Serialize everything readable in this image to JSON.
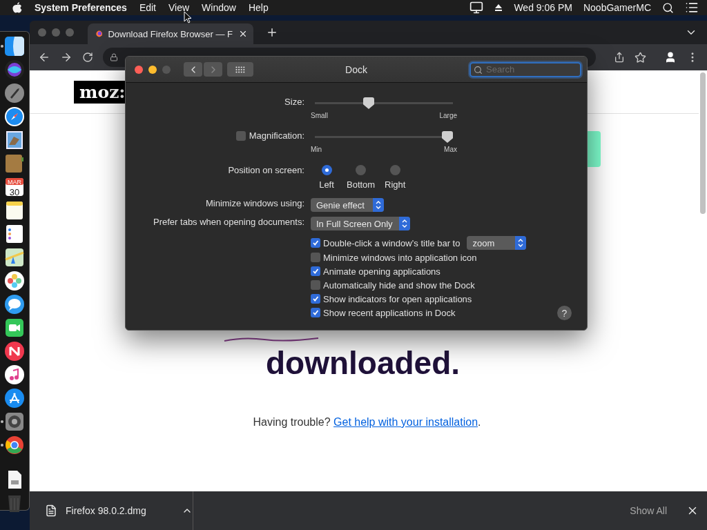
{
  "menu_bar": {
    "app": "System Preferences",
    "menus": [
      "Edit",
      "View",
      "Window",
      "Help"
    ],
    "clock": "Wed 9:06 PM",
    "user": "NoobGamerMC"
  },
  "dock": {
    "apps": [
      {
        "kind": "finder",
        "running": true
      },
      {
        "kind": "siri",
        "running": false
      },
      {
        "kind": "launchpad",
        "running": false
      },
      {
        "kind": "safari",
        "running": false
      },
      {
        "kind": "mail",
        "running": false
      },
      {
        "kind": "notefile",
        "running": false
      },
      {
        "kind": "calendar",
        "running": false,
        "month": "MAR",
        "day": "30"
      },
      {
        "kind": "notes",
        "running": false
      },
      {
        "kind": "reminders",
        "running": false
      },
      {
        "kind": "maps",
        "running": false
      },
      {
        "kind": "photos",
        "running": false
      },
      {
        "kind": "messages",
        "running": false
      },
      {
        "kind": "facetime",
        "running": false
      },
      {
        "kind": "news",
        "running": false
      },
      {
        "kind": "music",
        "running": false
      },
      {
        "kind": "appstore",
        "running": false
      },
      {
        "kind": "settings",
        "running": true
      },
      {
        "kind": "chrome",
        "running": true
      }
    ],
    "others": [
      {
        "kind": "document"
      },
      {
        "kind": "trash"
      }
    ]
  },
  "browser": {
    "tab": {
      "title": "Download Firefox Browser — F"
    },
    "page": {
      "logo": "moz:",
      "heading": [
        "downloaded."
      ],
      "help_text": "Having trouble? ",
      "help_link": "Get help with your installation",
      "help_end": "."
    },
    "downloads": {
      "file": "Firefox 98.0.2.dmg",
      "show_all": "Show All"
    }
  },
  "dock_preferences": {
    "title": "Dock",
    "navigation": {
      "back": {
        "disabled": false
      },
      "forward": {
        "disabled": true
      }
    },
    "search": {
      "placeholder": "Search"
    },
    "size": {
      "label": "Size:",
      "level": 0.39,
      "min_label": "Small",
      "max_label": "Large"
    },
    "magnification": {
      "label": "Magnification:",
      "checked": false,
      "level": 0.96,
      "min_label": "Min",
      "max_label": "Max"
    },
    "position": {
      "label": "Position on screen:",
      "options": [
        {
          "label": "Left",
          "selected": true
        },
        {
          "label": "Bottom",
          "selected": false
        },
        {
          "label": "Right",
          "selected": false
        }
      ]
    },
    "minimize": {
      "label": "Minimize windows using:",
      "value": "Genie effect"
    },
    "prefer_tabs": {
      "label": "Prefer tabs when opening documents:",
      "value": "In Full Screen Only"
    },
    "options": [
      {
        "label": "Double-click a window’s title bar to",
        "checked": true,
        "action": "zoom"
      },
      {
        "label": "Minimize windows into application icon",
        "checked": false
      },
      {
        "label": "Animate opening applications",
        "checked": true
      },
      {
        "label": "Automatically hide and show the Dock",
        "checked": false
      },
      {
        "label": "Show indicators for open applications",
        "checked": true
      },
      {
        "label": "Show recent applications in Dock",
        "checked": true
      }
    ],
    "help": "?"
  }
}
